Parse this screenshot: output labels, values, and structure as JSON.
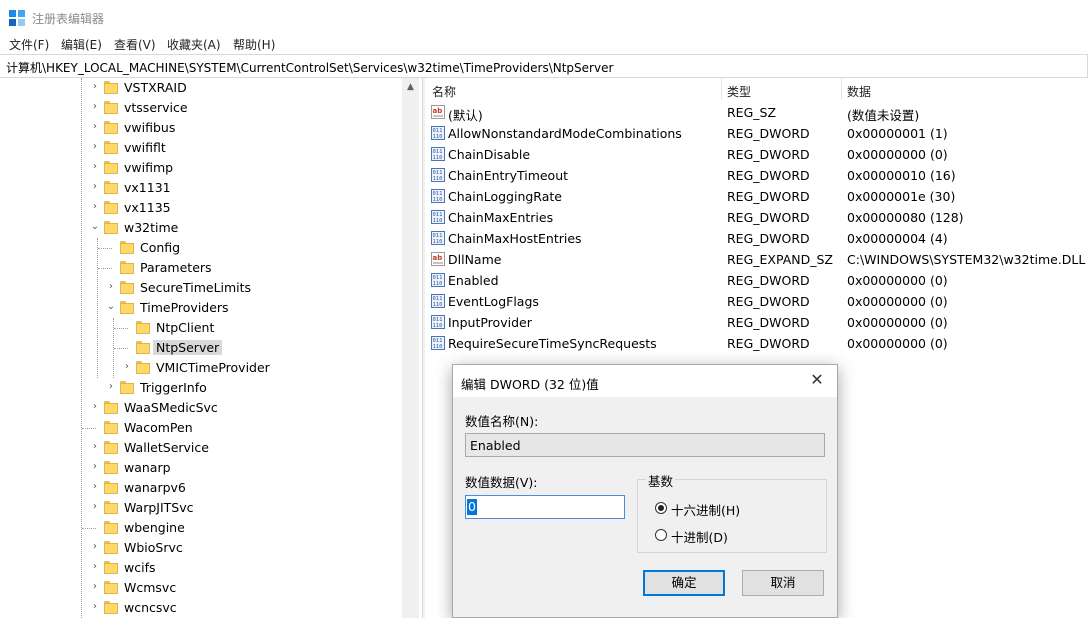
{
  "window": {
    "title": "注册表编辑器"
  },
  "menu": [
    "文件(F)",
    "编辑(E)",
    "查看(V)",
    "收藏夹(A)",
    "帮助(H)"
  ],
  "address": "计算机\\HKEY_LOCAL_MACHINE\\SYSTEM\\CurrentControlSet\\Services\\w32time\\TimeProviders\\NtpServer",
  "tree": [
    {
      "label": "VSTXRAID",
      "expandable": true
    },
    {
      "label": "vtsservice",
      "expandable": true
    },
    {
      "label": "vwifibus",
      "expandable": true
    },
    {
      "label": "vwififlt",
      "expandable": true
    },
    {
      "label": "vwifimp",
      "expandable": true
    },
    {
      "label": "vx1131",
      "expandable": true
    },
    {
      "label": "vx1135",
      "expandable": true
    },
    {
      "label": "w32time",
      "expandable": true,
      "expanded": true
    },
    {
      "label": "Config",
      "expandable": false
    },
    {
      "label": "Parameters",
      "expandable": false
    },
    {
      "label": "SecureTimeLimits",
      "expandable": true
    },
    {
      "label": "TimeProviders",
      "expandable": true,
      "expanded": true
    },
    {
      "label": "NtpClient",
      "expandable": false
    },
    {
      "label": "NtpServer",
      "expandable": false,
      "selected": true
    },
    {
      "label": "VMICTimeProvider",
      "expandable": true
    },
    {
      "label": "TriggerInfo",
      "expandable": true
    },
    {
      "label": "WaaSMedicSvc",
      "expandable": true
    },
    {
      "label": "WacomPen",
      "expandable": false
    },
    {
      "label": "WalletService",
      "expandable": true
    },
    {
      "label": "wanarp",
      "expandable": true
    },
    {
      "label": "wanarpv6",
      "expandable": true
    },
    {
      "label": "WarpJITSvc",
      "expandable": true
    },
    {
      "label": "wbengine",
      "expandable": false
    },
    {
      "label": "WbioSrvc",
      "expandable": true
    },
    {
      "label": "wcifs",
      "expandable": true
    },
    {
      "label": "Wcmsvc",
      "expandable": true
    },
    {
      "label": "wcncsvc",
      "expandable": true
    }
  ],
  "columns": {
    "name": "名称",
    "type": "类型",
    "data": "数据"
  },
  "values": [
    {
      "icon": "string-value-icon",
      "name": "(默认)",
      "type": "REG_SZ",
      "data": "(数值未设置)"
    },
    {
      "icon": "binary-value-icon",
      "name": "AllowNonstandardModeCombinations",
      "type": "REG_DWORD",
      "data": "0x00000001 (1)"
    },
    {
      "icon": "binary-value-icon",
      "name": "ChainDisable",
      "type": "REG_DWORD",
      "data": "0x00000000 (0)"
    },
    {
      "icon": "binary-value-icon",
      "name": "ChainEntryTimeout",
      "type": "REG_DWORD",
      "data": "0x00000010 (16)"
    },
    {
      "icon": "binary-value-icon",
      "name": "ChainLoggingRate",
      "type": "REG_DWORD",
      "data": "0x0000001e (30)"
    },
    {
      "icon": "binary-value-icon",
      "name": "ChainMaxEntries",
      "type": "REG_DWORD",
      "data": "0x00000080 (128)"
    },
    {
      "icon": "binary-value-icon",
      "name": "ChainMaxHostEntries",
      "type": "REG_DWORD",
      "data": "0x00000004 (4)"
    },
    {
      "icon": "string-value-icon",
      "name": "DllName",
      "type": "REG_EXPAND_SZ",
      "data": "C:\\WINDOWS\\SYSTEM32\\w32time.DLL"
    },
    {
      "icon": "binary-value-icon",
      "name": "Enabled",
      "type": "REG_DWORD",
      "data": "0x00000000 (0)"
    },
    {
      "icon": "binary-value-icon",
      "name": "EventLogFlags",
      "type": "REG_DWORD",
      "data": "0x00000000 (0)"
    },
    {
      "icon": "binary-value-icon",
      "name": "InputProvider",
      "type": "REG_DWORD",
      "data": "0x00000000 (0)"
    },
    {
      "icon": "binary-value-icon",
      "name": "RequireSecureTimeSyncRequests",
      "type": "REG_DWORD",
      "data": "0x00000000 (0)"
    }
  ],
  "dialog": {
    "title": "编辑 DWORD (32 位)值",
    "close": "✕",
    "name_label": "数值名称(N):",
    "name_value": "Enabled",
    "data_label": "数值数据(V):",
    "data_value": "0",
    "base_label": "基数",
    "hex_label": "十六进制(H)",
    "dec_label": "十进制(D)",
    "base_selected": "hex",
    "ok_label": "确定",
    "cancel_label": "取消"
  },
  "colors": {
    "selection_blue": "#0078d7",
    "folder_yellow": "#ffd86a"
  }
}
